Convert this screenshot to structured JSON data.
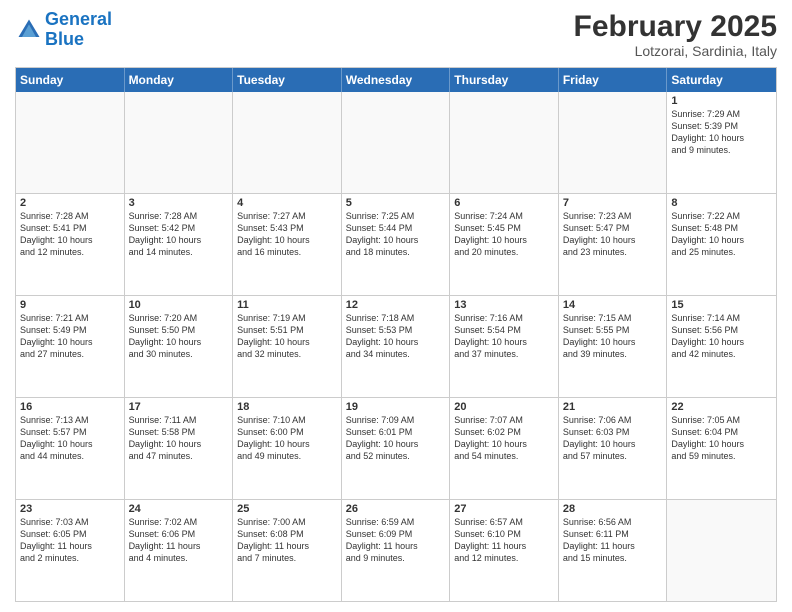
{
  "header": {
    "logo_line1": "General",
    "logo_line2": "Blue",
    "title": "February 2025",
    "subtitle": "Lotzorai, Sardinia, Italy"
  },
  "weekdays": [
    "Sunday",
    "Monday",
    "Tuesday",
    "Wednesday",
    "Thursday",
    "Friday",
    "Saturday"
  ],
  "weeks": [
    [
      {
        "day": "",
        "info": ""
      },
      {
        "day": "",
        "info": ""
      },
      {
        "day": "",
        "info": ""
      },
      {
        "day": "",
        "info": ""
      },
      {
        "day": "",
        "info": ""
      },
      {
        "day": "",
        "info": ""
      },
      {
        "day": "1",
        "info": "Sunrise: 7:29 AM\nSunset: 5:39 PM\nDaylight: 10 hours\nand 9 minutes."
      }
    ],
    [
      {
        "day": "2",
        "info": "Sunrise: 7:28 AM\nSunset: 5:41 PM\nDaylight: 10 hours\nand 12 minutes."
      },
      {
        "day": "3",
        "info": "Sunrise: 7:28 AM\nSunset: 5:42 PM\nDaylight: 10 hours\nand 14 minutes."
      },
      {
        "day": "4",
        "info": "Sunrise: 7:27 AM\nSunset: 5:43 PM\nDaylight: 10 hours\nand 16 minutes."
      },
      {
        "day": "5",
        "info": "Sunrise: 7:25 AM\nSunset: 5:44 PM\nDaylight: 10 hours\nand 18 minutes."
      },
      {
        "day": "6",
        "info": "Sunrise: 7:24 AM\nSunset: 5:45 PM\nDaylight: 10 hours\nand 20 minutes."
      },
      {
        "day": "7",
        "info": "Sunrise: 7:23 AM\nSunset: 5:47 PM\nDaylight: 10 hours\nand 23 minutes."
      },
      {
        "day": "8",
        "info": "Sunrise: 7:22 AM\nSunset: 5:48 PM\nDaylight: 10 hours\nand 25 minutes."
      }
    ],
    [
      {
        "day": "9",
        "info": "Sunrise: 7:21 AM\nSunset: 5:49 PM\nDaylight: 10 hours\nand 27 minutes."
      },
      {
        "day": "10",
        "info": "Sunrise: 7:20 AM\nSunset: 5:50 PM\nDaylight: 10 hours\nand 30 minutes."
      },
      {
        "day": "11",
        "info": "Sunrise: 7:19 AM\nSunset: 5:51 PM\nDaylight: 10 hours\nand 32 minutes."
      },
      {
        "day": "12",
        "info": "Sunrise: 7:18 AM\nSunset: 5:53 PM\nDaylight: 10 hours\nand 34 minutes."
      },
      {
        "day": "13",
        "info": "Sunrise: 7:16 AM\nSunset: 5:54 PM\nDaylight: 10 hours\nand 37 minutes."
      },
      {
        "day": "14",
        "info": "Sunrise: 7:15 AM\nSunset: 5:55 PM\nDaylight: 10 hours\nand 39 minutes."
      },
      {
        "day": "15",
        "info": "Sunrise: 7:14 AM\nSunset: 5:56 PM\nDaylight: 10 hours\nand 42 minutes."
      }
    ],
    [
      {
        "day": "16",
        "info": "Sunrise: 7:13 AM\nSunset: 5:57 PM\nDaylight: 10 hours\nand 44 minutes."
      },
      {
        "day": "17",
        "info": "Sunrise: 7:11 AM\nSunset: 5:58 PM\nDaylight: 10 hours\nand 47 minutes."
      },
      {
        "day": "18",
        "info": "Sunrise: 7:10 AM\nSunset: 6:00 PM\nDaylight: 10 hours\nand 49 minutes."
      },
      {
        "day": "19",
        "info": "Sunrise: 7:09 AM\nSunset: 6:01 PM\nDaylight: 10 hours\nand 52 minutes."
      },
      {
        "day": "20",
        "info": "Sunrise: 7:07 AM\nSunset: 6:02 PM\nDaylight: 10 hours\nand 54 minutes."
      },
      {
        "day": "21",
        "info": "Sunrise: 7:06 AM\nSunset: 6:03 PM\nDaylight: 10 hours\nand 57 minutes."
      },
      {
        "day": "22",
        "info": "Sunrise: 7:05 AM\nSunset: 6:04 PM\nDaylight: 10 hours\nand 59 minutes."
      }
    ],
    [
      {
        "day": "23",
        "info": "Sunrise: 7:03 AM\nSunset: 6:05 PM\nDaylight: 11 hours\nand 2 minutes."
      },
      {
        "day": "24",
        "info": "Sunrise: 7:02 AM\nSunset: 6:06 PM\nDaylight: 11 hours\nand 4 minutes."
      },
      {
        "day": "25",
        "info": "Sunrise: 7:00 AM\nSunset: 6:08 PM\nDaylight: 11 hours\nand 7 minutes."
      },
      {
        "day": "26",
        "info": "Sunrise: 6:59 AM\nSunset: 6:09 PM\nDaylight: 11 hours\nand 9 minutes."
      },
      {
        "day": "27",
        "info": "Sunrise: 6:57 AM\nSunset: 6:10 PM\nDaylight: 11 hours\nand 12 minutes."
      },
      {
        "day": "28",
        "info": "Sunrise: 6:56 AM\nSunset: 6:11 PM\nDaylight: 11 hours\nand 15 minutes."
      },
      {
        "day": "",
        "info": ""
      }
    ]
  ]
}
